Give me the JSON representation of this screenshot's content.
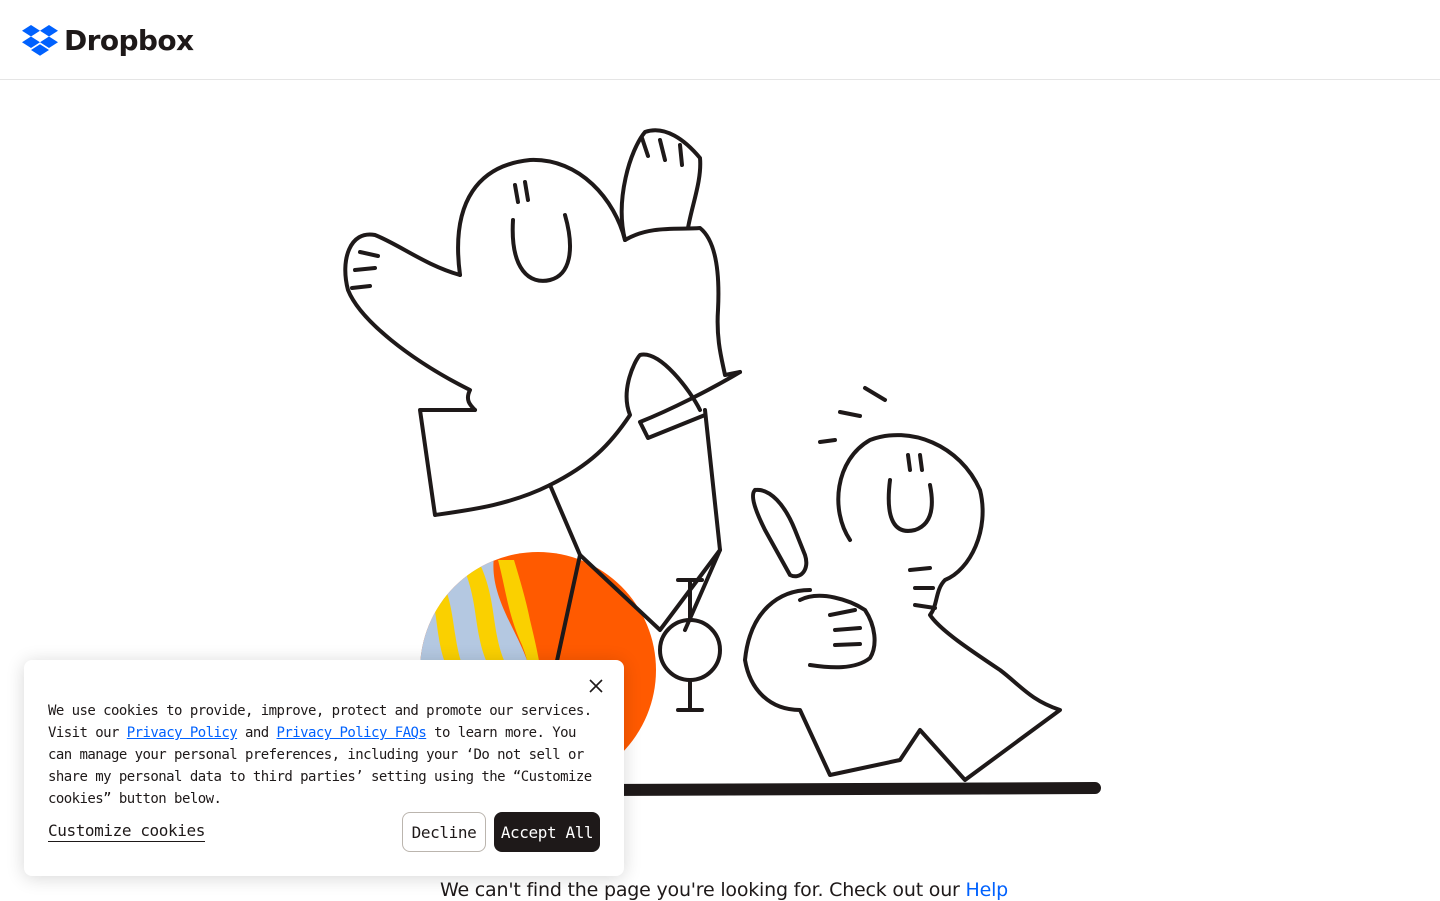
{
  "header": {
    "logo_text": "Dropbox",
    "brand_color": "#0061fe"
  },
  "illustration": {
    "icon": "two-characters-with-bicycle-illustration"
  },
  "message": {
    "text": "We can't find the page you're looking for. Check out our ",
    "link": "Help"
  },
  "cookie_banner": {
    "text_before": "We use cookies to provide, improve, protect and promote our services. Visit our ",
    "privacy_policy_link": "Privacy Policy",
    "and": " and ",
    "privacy_faq_link": "Privacy Policy FAQs",
    "text_after": " to learn more. You can manage your personal preferences, including your ‘Do not sell or share my personal data to third parties’ setting using the “Customize cookies” button below.",
    "customize_label": "Customize cookies",
    "decline_label": "Decline",
    "accept_label": "Accept All",
    "close_icon": "close-icon"
  },
  "colors": {
    "accent": "#0061fe",
    "dark": "#1e1919",
    "orange": "#ff5a00",
    "yellow": "#fad000",
    "light_blue": "#b4c8e1"
  }
}
